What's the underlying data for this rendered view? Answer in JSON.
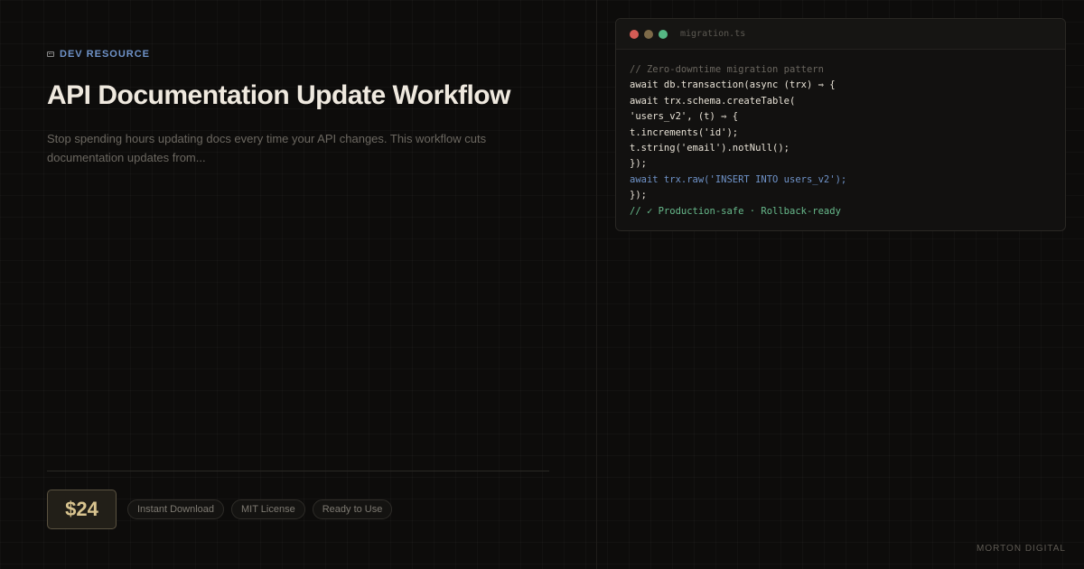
{
  "eyebrow": {
    "icon": "keyboard-icon",
    "label": "DEV RESOURCE"
  },
  "title": "API Documentation Update Workflow",
  "description": "Stop spending hours updating docs every time your API changes. This workflow cuts documentation updates from...",
  "price": "$24",
  "tags": [
    "Instant Download",
    "MIT License",
    "Ready to Use"
  ],
  "brand": "MORTON DIGITAL",
  "editor": {
    "filename": "migration.ts",
    "lines": [
      "// Zero-downtime migration pattern",
      "await db.transaction(async (trx) ⇒ {",
      "await trx.schema.createTable(",
      "'users_v2', (t) ⇒ {",
      "t.increments('id');",
      "t.string('email').notNull();",
      "});",
      "await trx.raw('INSERT INTO users_v2');",
      "});",
      "// ✓ Production-safe · Rollback-ready"
    ]
  },
  "colors": {
    "accent_blue": "#6f93c9",
    "accent_green": "#67b98b",
    "price_gold": "#d9c48f",
    "background": "#0d0c0b"
  }
}
